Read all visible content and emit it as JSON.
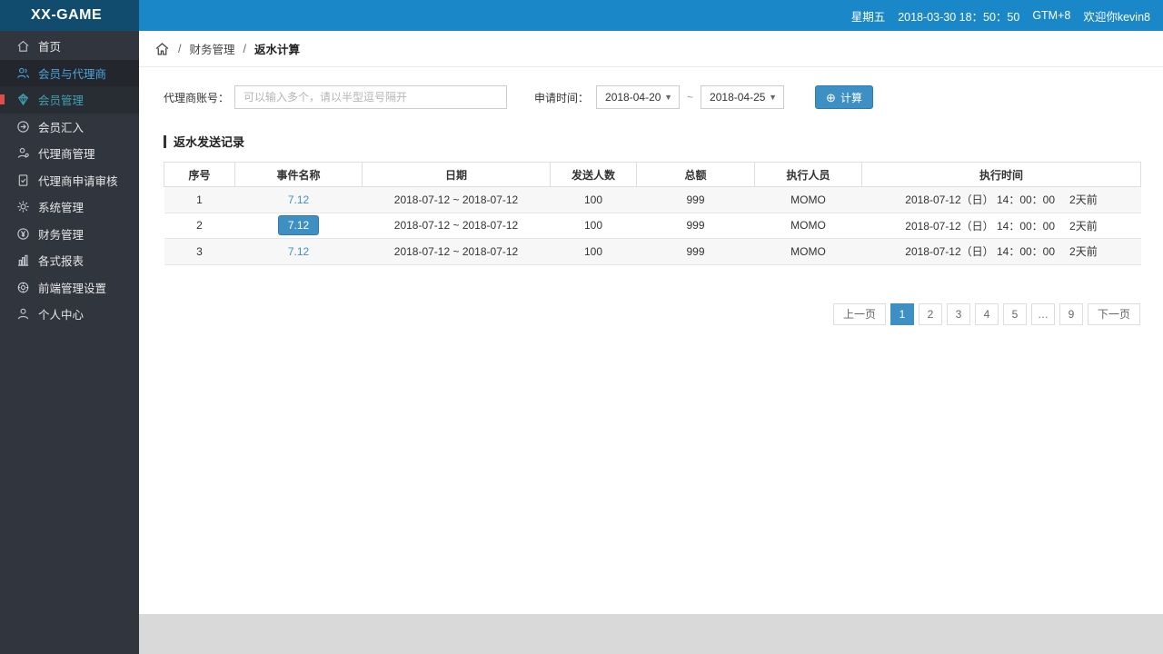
{
  "app": {
    "logo": "XX-GAME"
  },
  "topbar": {
    "weekday": "星期五",
    "datetime": "2018-03-30 18：50：50",
    "timezone": "GTM+8",
    "welcome": "欢迎你kevin8"
  },
  "sidebar": {
    "items": [
      {
        "label": "首页",
        "icon": "home-icon"
      },
      {
        "label": "会员与代理商",
        "icon": "members-icon"
      },
      {
        "label": "会员管理",
        "icon": "member-manage-icon"
      },
      {
        "label": "会员汇入",
        "icon": "member-import-icon"
      },
      {
        "label": "代理商管理",
        "icon": "agent-manage-icon"
      },
      {
        "label": "代理商申请审核",
        "icon": "agent-audit-icon"
      },
      {
        "label": "系统管理",
        "icon": "system-icon"
      },
      {
        "label": "财务管理",
        "icon": "finance-icon"
      },
      {
        "label": "各式报表",
        "icon": "reports-icon"
      },
      {
        "label": "前端管理设置",
        "icon": "frontend-icon"
      },
      {
        "label": "个人中心",
        "icon": "profile-icon"
      }
    ]
  },
  "breadcrumb": {
    "separator": "/",
    "level1": "财务管理",
    "level2": "返水计算"
  },
  "filters": {
    "account_label": "代理商账号：",
    "account_placeholder": "可以输入多个，请以半型逗号隔开",
    "time_label": "申请时间：",
    "date_from": "2018-04-20",
    "date_to": "2018-04-25",
    "range_separator": "~",
    "calc_icon": "⊕",
    "calc_label": "计算"
  },
  "section": {
    "title": "返水发送记录"
  },
  "table": {
    "headers": [
      "序号",
      "事件名称",
      "日期",
      "发送人数",
      "总额",
      "执行人员",
      "执行时间"
    ],
    "rows": [
      {
        "no": "1",
        "event": "7.12",
        "date": "2018-07-12 ~ 2018-07-12",
        "count": "100",
        "total": "999",
        "operator": "MOMO",
        "exec_time": "2018-07-12（日） 14：00：00",
        "exec_ago": "2天前"
      },
      {
        "no": "2",
        "event": "7.12",
        "date": "2018-07-12 ~ 2018-07-12",
        "count": "100",
        "total": "999",
        "operator": "MOMO",
        "exec_time": "2018-07-12（日） 14：00：00",
        "exec_ago": "2天前"
      },
      {
        "no": "3",
        "event": "7.12",
        "date": "2018-07-12 ~ 2018-07-12",
        "count": "100",
        "total": "999",
        "operator": "MOMO",
        "exec_time": "2018-07-12（日） 14：00：00",
        "exec_ago": "2天前"
      }
    ]
  },
  "pagination": {
    "prev": "上一页",
    "pages": [
      "1",
      "2",
      "3",
      "4",
      "5",
      "…",
      "9"
    ],
    "active": "1",
    "next": "下一页"
  },
  "colors": {
    "topbar_blue": "#1a87c9",
    "logo_dark": "#114b6d",
    "sidebar_dark": "#31353d",
    "accent_blue": "#3d8fc4",
    "link_blue": "#4191bd",
    "alert_red": "#e14c4c"
  }
}
